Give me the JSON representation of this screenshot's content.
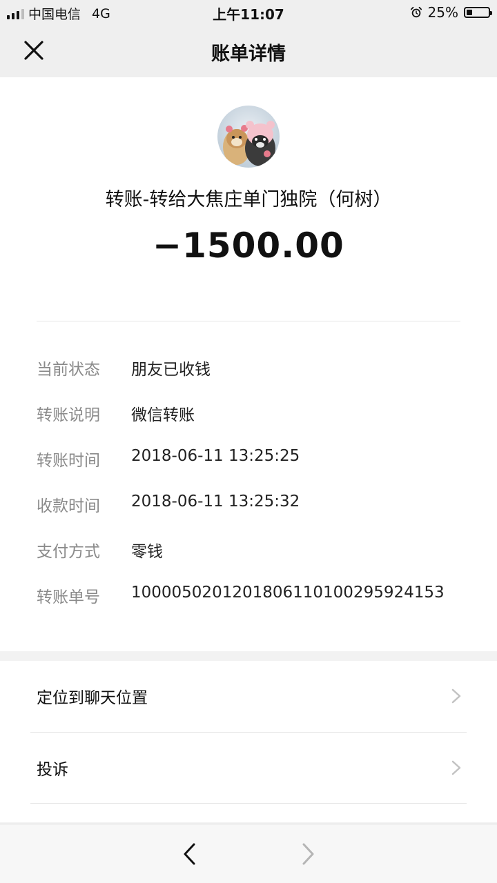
{
  "status_bar": {
    "carrier": "中国电信",
    "network": "4G",
    "time": "上午11:07",
    "battery": "25%",
    "battery_level": 0.25,
    "icons": [
      "signal-icon",
      "alarm-icon",
      "battery-icon"
    ]
  },
  "nav": {
    "title": "账单详情",
    "close_icon": "close-icon"
  },
  "transaction": {
    "payee": "转账-转给大焦庄单门独院（何树）",
    "amount": "−1500.00",
    "details": [
      {
        "label": "当前状态",
        "value": "朋友已收钱"
      },
      {
        "label": "转账说明",
        "value": "微信转账"
      },
      {
        "label": "转账时间",
        "value": "2018-06-11 13:25:25"
      },
      {
        "label": "收款时间",
        "value": "2018-06-11 13:25:32"
      },
      {
        "label": "支付方式",
        "value": "零钱"
      },
      {
        "label": "转账单号",
        "value": "1000050201201806110100295924153"
      }
    ]
  },
  "actions": [
    {
      "label": "定位到聊天位置",
      "icon": "chevron-right-icon"
    },
    {
      "label": "投诉",
      "icon": "chevron-right-icon"
    }
  ],
  "bottom_bar": {
    "icons": [
      "back-arrow-icon",
      "forward-arrow-icon"
    ]
  },
  "colors": {
    "background": "#f2f2f2",
    "card": "#ffffff",
    "label_gray": "#8a8a8a",
    "text": "#111111",
    "divider": "#e6e6e6"
  }
}
